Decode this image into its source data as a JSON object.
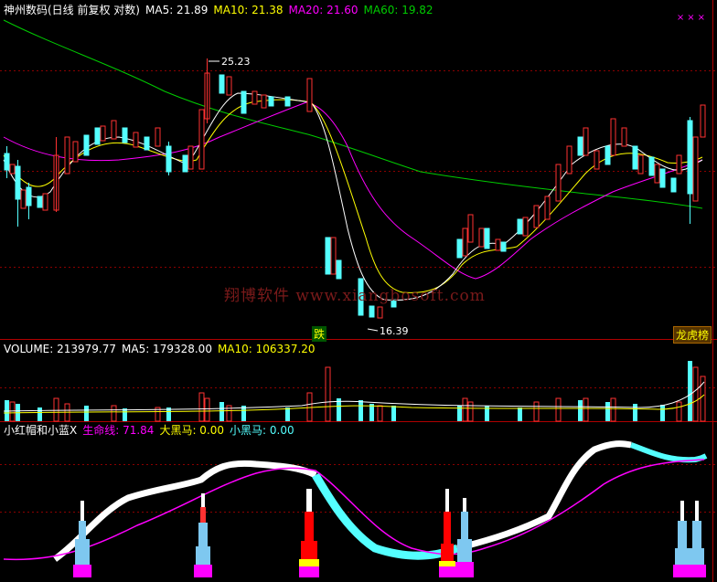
{
  "main_header": {
    "title": "神州数码(日线 前复权 对数)",
    "ma5": "MA5: 21.89",
    "ma10": "MA10: 21.38",
    "ma20": "MA20: 21.60",
    "ma60": "MA60: 19.82"
  },
  "volume_header": {
    "label": "VOLUME: 213979.77",
    "ma5": "MA5: 179328.00",
    "ma10": "MA10: 106337.20"
  },
  "indicator_header": {
    "name": "小红帽和小蓝X",
    "life_line": "生命线: 71.84",
    "big_black_horse": "大黑马: 0.00",
    "small_black_horse": "小黑马: 0.00"
  },
  "annotations": {
    "high_label": "25.23",
    "low_label": "16.39",
    "tag_drop": "跌",
    "tag_rank": "龙虎榜"
  },
  "watermark": "翔博软件 www.xiangbosoft.com",
  "colors": {
    "up": "#ff3232",
    "down": "#54ffff",
    "ma5": "#ffffff",
    "ma10": "#ffff00",
    "ma20": "#ff00ff",
    "ma60": "#00cc00",
    "grid": "#8b0000"
  },
  "chart_data": {
    "type": "candlestick",
    "price_high": 25.23,
    "price_low": 16.39,
    "volume": 213979.77,
    "volume_ma5": 179328.0,
    "volume_ma10": 106337.2,
    "ma5": 21.89,
    "ma10": 21.38,
    "ma20": 21.6,
    "ma60": 19.82,
    "life_line": 71.84
  }
}
